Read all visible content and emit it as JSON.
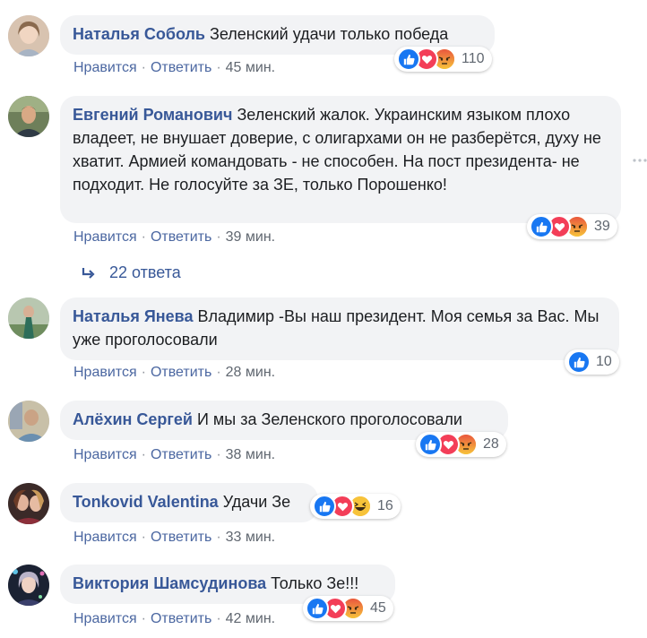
{
  "comments": [
    {
      "author": "Наталья Соболь",
      "text": "Зеленский удачи только победа",
      "like_label": "Нравится",
      "reply_label": "Ответить",
      "time": "45 мин.",
      "reactions": [
        "like",
        "love",
        "angry"
      ],
      "reaction_count": "110"
    },
    {
      "author": "Евгений Романович",
      "text": "Зеленский жалок. Украинским языком плохо владеет, не внушает доверие, с олигархами он не разберётся, духу не хватит. Армией командовать - не способен. На пост президента- не подходит. Не голосуйте за ЗЕ, только Порошенко!",
      "like_label": "Нравится",
      "reply_label": "Ответить",
      "time": "39 мин.",
      "reactions": [
        "like",
        "love",
        "angry"
      ],
      "reaction_count": "39",
      "replies_label": "22 ответа"
    },
    {
      "author": "Наталья Янева",
      "text": "Владимир -Вы наш президент. Моя семья за Вас. Мы уже проголосовали",
      "like_label": "Нравится",
      "reply_label": "Ответить",
      "time": "28 мин.",
      "reactions": [
        "like"
      ],
      "reaction_count": "10"
    },
    {
      "author": "Алёхин Сергей",
      "text": "И мы за Зеленского проголосовали",
      "like_label": "Нравится",
      "reply_label": "Ответить",
      "time": "38 мин.",
      "reactions": [
        "like",
        "love",
        "angry"
      ],
      "reaction_count": "28"
    },
    {
      "author": "Tonkovid Valentina",
      "text": "Удачи Зе",
      "like_label": "Нравится",
      "reply_label": "Ответить",
      "time": "33 мин.",
      "reactions": [
        "like",
        "love",
        "haha"
      ],
      "reaction_count": "16"
    },
    {
      "author": "Виктория Шамсудинова",
      "text": "Только Зе!!!",
      "like_label": "Нравится",
      "reply_label": "Ответить",
      "time": "42 мин.",
      "reactions": [
        "like",
        "love",
        "angry"
      ],
      "reaction_count": "45"
    }
  ],
  "separator": "·",
  "colors": {
    "author": "#385898",
    "link": "#4b67a1",
    "bubble": "#f2f3f5",
    "like": "#1877f2",
    "love": "#f33e58",
    "angry": "#f7b125"
  }
}
